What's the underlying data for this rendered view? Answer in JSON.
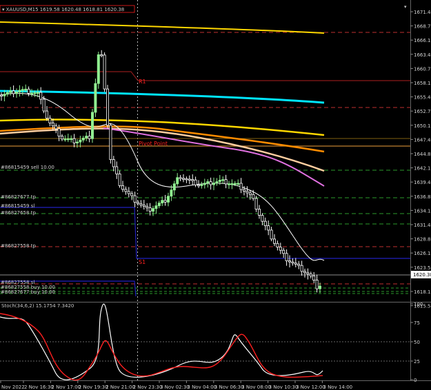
{
  "header": {
    "symbol_line": "▾ XAUUSD,M15  1619.58 1620.48 1618.81 1620.38"
  },
  "price_axis": {
    "ticks": [
      "1671.40",
      "1668.75",
      "1666.10",
      "1663.45",
      "1660.75",
      "1658.10",
      "1655.45",
      "1652.75",
      "1650.10",
      "1647.45",
      "1644.80",
      "1642.10",
      "1639.45",
      "1636.80",
      "1634.15",
      "1631.45",
      "1628.80",
      "1626.15",
      "1623.50",
      "1618.15",
      "1615.50"
    ],
    "current_price": "1620.38",
    "current_color": "#ffffff"
  },
  "osc_axis": {
    "ticks": [
      "100",
      "75",
      "50",
      "25",
      "0"
    ]
  },
  "oscillator": {
    "label": "Stoch(34,6,2) 15.1754 7.3420"
  },
  "time_axis": {
    "labels": [
      "Nov 2022",
      "2 Nov 16:30",
      "2 Nov 17:00",
      "2 Nov 19:30",
      "2 Nov 21:00",
      "2 Nov 23:30",
      "3 Nov 02:30",
      "3 Nov 04:00",
      "3 Nov 06:30",
      "3 Nov 08:00",
      "3 Nov 10:30",
      "3 Nov 12:00",
      "3 Nov 14:00"
    ]
  },
  "levels": {
    "r1": "R1",
    "pivot": "Pivot Point",
    "s1": "S1"
  },
  "orders": [
    "#86815459 sell 10.00",
    "#86827677 tp",
    "#86815459 sl",
    "#86827658 tp",
    "#86827558 tp",
    "#86827558 sl",
    "#86827558 buy 10.00",
    "#86827677 buy 10.00"
  ],
  "colors": {
    "bull": "#90ee90",
    "bear": "#ffffff",
    "ma_yellow": "#ffd700",
    "ma_cyan": "#00e5ff",
    "ma_orange": "#ff8c00",
    "ma_peach": "#ffcfa0",
    "ma_violet": "#e070e0",
    "stoch_main": "#ffffff",
    "stoch_signal": "#ff2020"
  }
}
